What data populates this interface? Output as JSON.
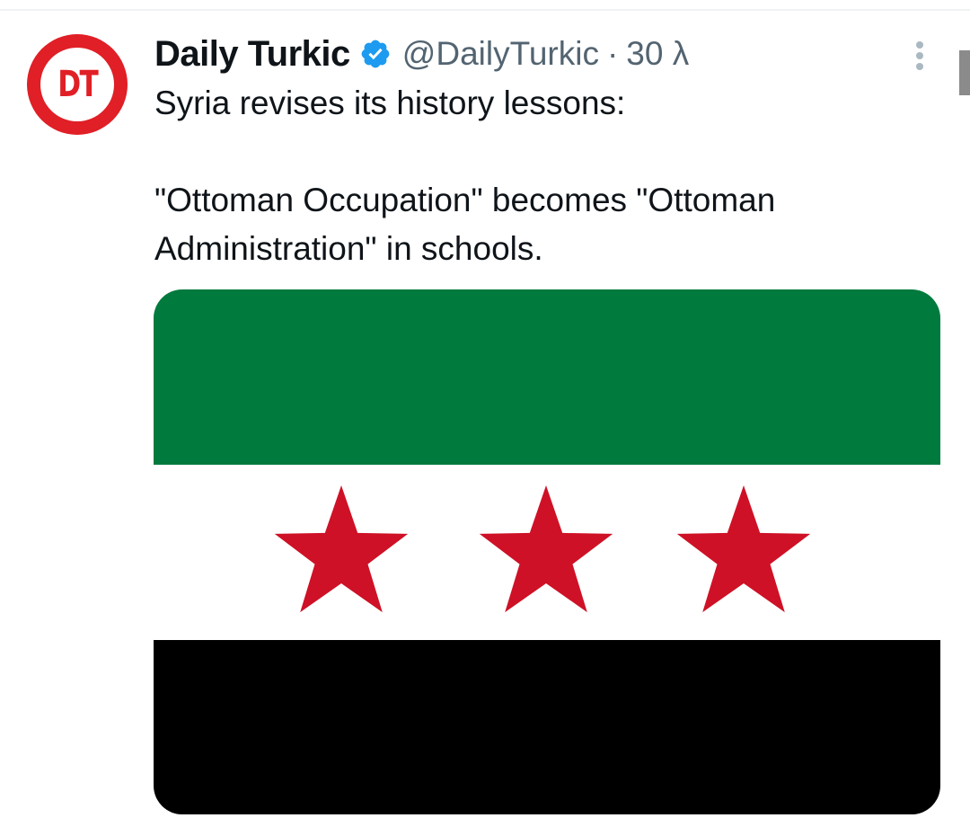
{
  "tweet": {
    "author": {
      "display_name": "Daily Turkic",
      "handle": "@DailyTurkic",
      "avatar_text": "DT",
      "verified": true
    },
    "separator": "·",
    "timestamp": "30 λ",
    "text_lines": [
      "Syria revises its history lessons:",
      "\"Ottoman Occupation\" becomes \"Ottoman\nAdministration\" in schools."
    ],
    "media": {
      "type": "flag",
      "stripe_colors": [
        "#007a3d",
        "#ffffff",
        "#000000"
      ],
      "star_color": "#ce1126",
      "star_count": 3
    }
  },
  "icons": {
    "verified": "verified-badge-icon",
    "more": "more-options-icon"
  },
  "colors": {
    "brand_red": "#e01f26",
    "verified_blue": "#1d9bf0",
    "secondary_text": "#536471",
    "primary_text": "#0f1419"
  }
}
